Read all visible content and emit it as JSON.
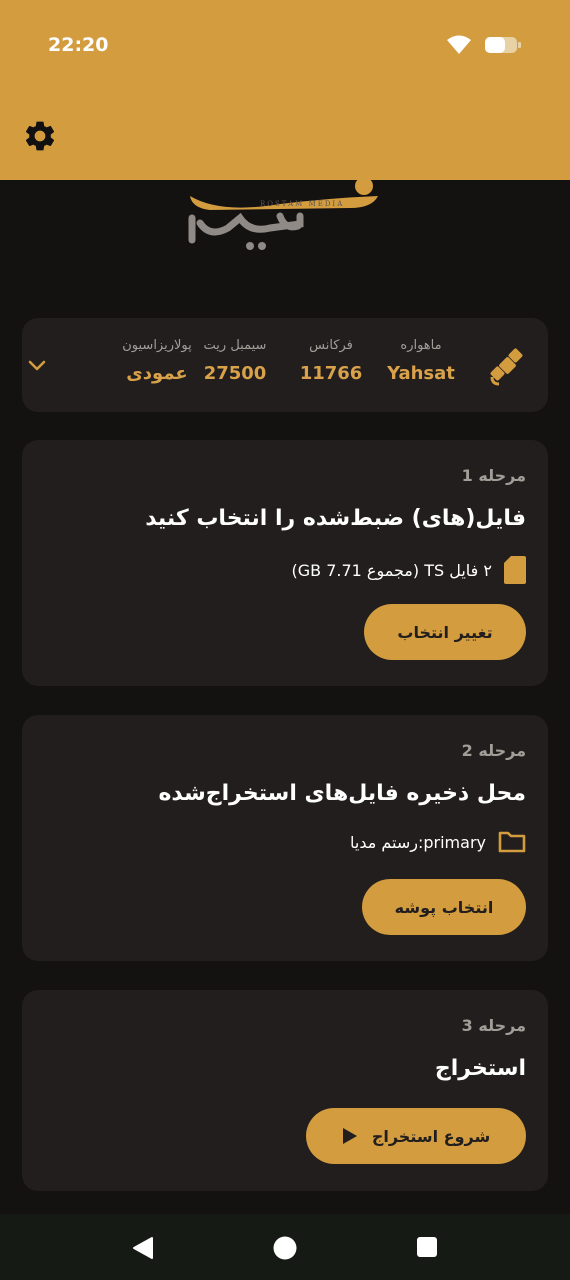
{
  "status_bar": {
    "time": "22:20"
  },
  "satellite": {
    "columns": [
      {
        "label": "ماهواره",
        "value": "Yahsat"
      },
      {
        "label": "فرکانس",
        "value": "11766"
      },
      {
        "label": "سیمبل ریت",
        "value": "27500"
      },
      {
        "label": "پولاریزاسیون",
        "value": "عمودی"
      }
    ]
  },
  "steps": [
    {
      "label": "مرحله 1",
      "title": "فایل(های) ضبط‌شده را انتخاب کنید",
      "info": "۲ فایل TS (مجموع 7.71 GB)",
      "button": "تغییر انتخاب"
    },
    {
      "label": "مرحله 2",
      "title": "محل ذخیره فایل‌های استخراج‌شده",
      "info": "primary:رستم مدیا",
      "button": "انتخاب پوشه"
    },
    {
      "label": "مرحله 3",
      "title": "استخراج",
      "button": "شروع استخراج"
    }
  ],
  "colors": {
    "accent": "#d29c3f",
    "background": "#141211",
    "card": "#211e1d"
  }
}
